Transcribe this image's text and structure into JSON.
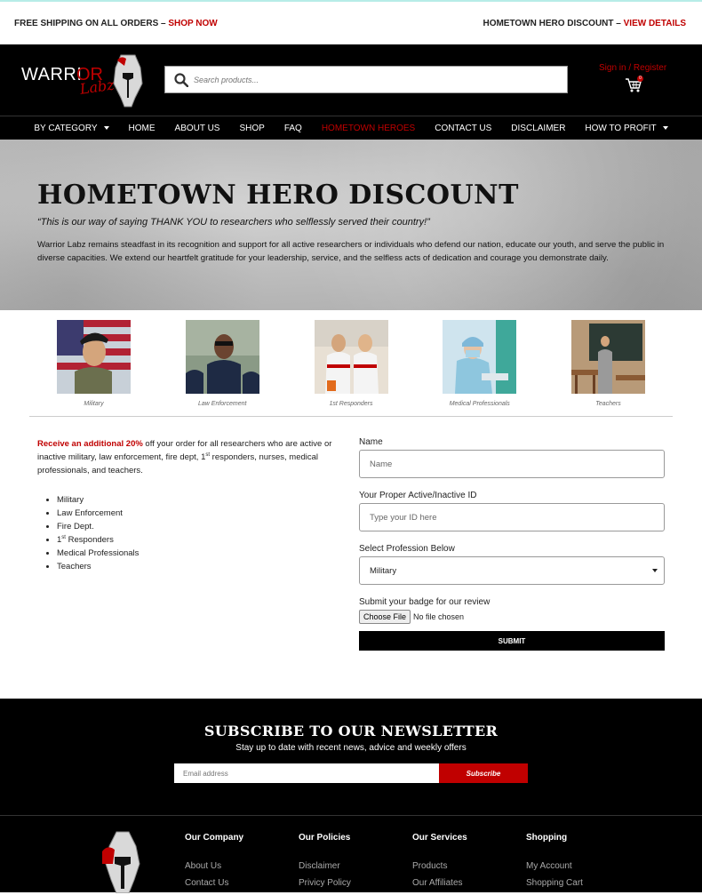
{
  "topbar": {
    "left_text": "FREE SHIPPING ON ALL ORDERS – ",
    "left_link": "SHOP NOW",
    "right_text": "HOMETOWN HERO DISCOUNT – ",
    "right_link": "VIEW DETAILS"
  },
  "header": {
    "logo_text": "WARRIOR LABZ",
    "search_placeholder": "Search products...",
    "signin": "Sign in / Register",
    "cart_count": "0"
  },
  "nav": {
    "items": [
      {
        "label": "BY CATEGORY",
        "dropdown": true
      },
      {
        "label": "HOME"
      },
      {
        "label": "ABOUT US"
      },
      {
        "label": "SHOP"
      },
      {
        "label": "FAQ"
      },
      {
        "label": "HOMETOWN HEROES",
        "active": true
      },
      {
        "label": "CONTACT US"
      },
      {
        "label": "DISCLAIMER"
      },
      {
        "label": "HOW TO PROFIT",
        "dropdown": true
      }
    ]
  },
  "hero": {
    "title": "HOMETOWN HERO DISCOUNT",
    "quote": "“This is our way of saying THANK YOU to researchers who selflessly served their country!”",
    "text": "Warrior Labz remains steadfast in its recognition and support for all active researchers or individuals who defend our nation, educate our youth, and serve the public in diverse capacities. We extend our heartfelt gratitude for your leadership, service, and the selfless acts of dedication and courage you demonstrate daily."
  },
  "photos": [
    {
      "caption": "Military"
    },
    {
      "caption": "Law Enforcement"
    },
    {
      "caption": "1st Responders"
    },
    {
      "caption": "Medical Professionals"
    },
    {
      "caption": "Teachers"
    }
  ],
  "offer": {
    "highlight": "Receive an additional 20%",
    "text_a": " off your order for all researchers who are active or inactive military, law enforcement, fire dept, 1",
    "text_sup": "st",
    "text_b": " responders, nurses, medical professionals, and teachers.",
    "list": [
      "Military",
      "Law Enforcement",
      "Fire Dept.",
      "Responders",
      "Medical Professionals",
      "Teachers"
    ],
    "list_prefix_1st": "1",
    "list_sup": "st"
  },
  "form": {
    "name_label": "Name",
    "name_placeholder": "Name",
    "id_label": "Your Proper Active/Inactive ID",
    "id_placeholder": "Type your ID here",
    "profession_label": "Select Profession Below",
    "profession_value": "Military",
    "badge_label": "Submit your badge for our review",
    "file_button": "Choose File",
    "file_status": "No file chosen",
    "submit": "SUBMIT"
  },
  "newsletter": {
    "title": "SUBSCRIBE TO OUR NEWSLETTER",
    "subtitle": "Stay up to date with recent news, advice and weekly offers",
    "placeholder": "Email address",
    "button": "Subscribe"
  },
  "footer": {
    "columns": [
      {
        "heading": "Our Company",
        "links": [
          "About Us",
          "Contact Us"
        ]
      },
      {
        "heading": "Our Policies",
        "links": [
          "Disclaimer",
          "Privicy Policy"
        ]
      },
      {
        "heading": "Our Services",
        "links": [
          "Products",
          "Our Affiliates"
        ]
      },
      {
        "heading": "Shopping",
        "links": [
          "My Account",
          "Shopping Cart"
        ]
      }
    ]
  },
  "colors": {
    "accent": "#c00000",
    "dark": "#000000"
  }
}
